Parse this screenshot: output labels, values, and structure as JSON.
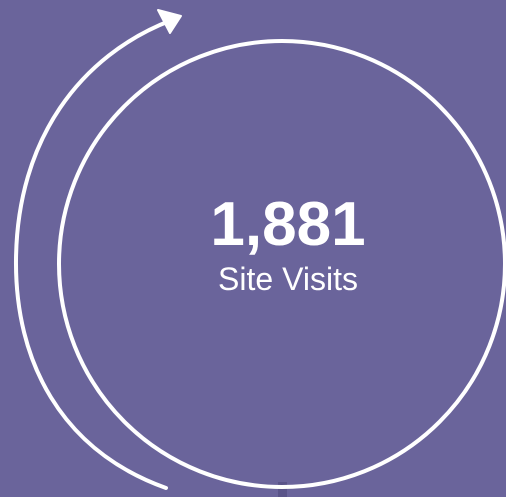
{
  "stat": {
    "value": "1,881",
    "label": "Site Visits"
  },
  "colors": {
    "background": "#6a649b",
    "stroke": "#ffffff",
    "connector": "#5a5489"
  },
  "icons": {
    "arrow": "curved-arrow-icon"
  }
}
